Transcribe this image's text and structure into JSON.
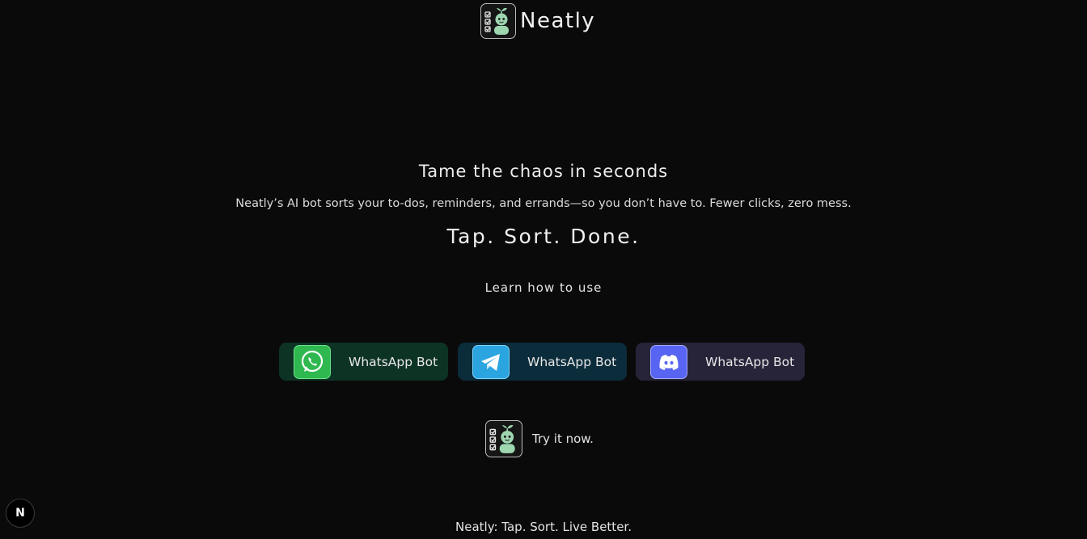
{
  "header": {
    "brand_name": "Neatly",
    "logo_icon": "robot-checklist-icon"
  },
  "hero": {
    "title": "Tame the chaos in seconds",
    "description": "Neatly’s AI bot sorts your to-dos, reminders, and errands—so you don’t have to. Fewer clicks, zero mess.",
    "tagline": "Tap. Sort. Done.",
    "learn_link": "Learn how to use"
  },
  "bots": [
    {
      "label": "WhatsApp Bot",
      "icon": "whatsapp-icon",
      "bg": "#0d3325",
      "icon_color": "#25d366"
    },
    {
      "label": "WhatsApp Bot",
      "icon": "telegram-icon",
      "bg": "#0b2c3a",
      "icon_color": "#29a9eb"
    },
    {
      "label": "WhatsApp Bot",
      "icon": "discord-icon",
      "bg": "#272339",
      "icon_color": "#5865f2"
    }
  ],
  "try_now": {
    "label": "Try it now.",
    "icon": "robot-checklist-icon"
  },
  "dev_badge": {
    "letter": "N",
    "icon": "nextjs-icon"
  },
  "footer": {
    "text": "Neatly: Tap. Sort. Live Better."
  }
}
